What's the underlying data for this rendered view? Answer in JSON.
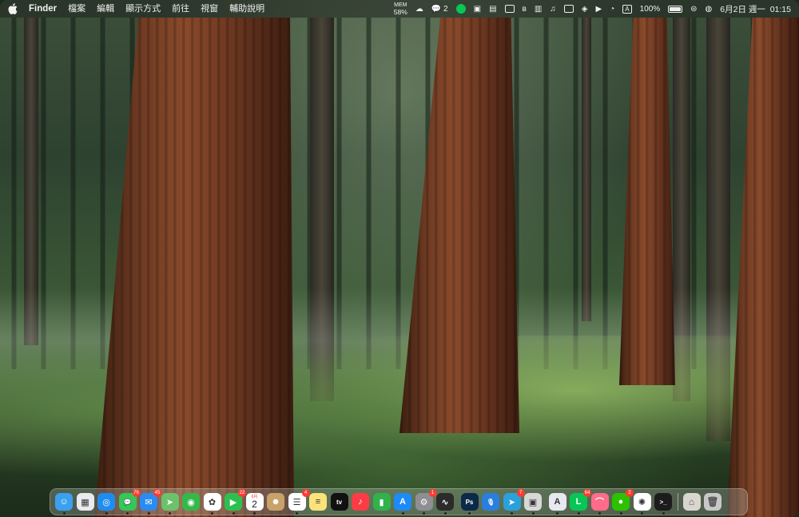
{
  "menubar": {
    "app_name": "Finder",
    "menus": [
      "檔案",
      "編輯",
      "顯示方式",
      "前往",
      "視窗",
      "輔助說明"
    ],
    "mem_label": "MEM",
    "mem_value": "58%",
    "wechat_count": "2",
    "battery_percent": "100%",
    "date_time": "6月2日 週一  01:15"
  },
  "dock": {
    "apps": [
      {
        "name": "Finder",
        "color": "#3aa0f0",
        "badge": "",
        "running": true,
        "glyph": "☺"
      },
      {
        "name": "Launchpad",
        "color": "#e9e9ef",
        "badge": "",
        "running": false,
        "glyph": "▦"
      },
      {
        "name": "Safari",
        "color": "#1f8cf0",
        "badge": "",
        "running": true,
        "glyph": "◎"
      },
      {
        "name": "Messages",
        "color": "#34c759",
        "badge": "76",
        "running": true,
        "glyph": "💬"
      },
      {
        "name": "Mail",
        "color": "#2a8bf2",
        "badge": "45",
        "running": true,
        "glyph": "✉"
      },
      {
        "name": "Maps",
        "color": "#6cc26a",
        "badge": "",
        "running": true,
        "glyph": "➤"
      },
      {
        "name": "Find My",
        "color": "#35b84a",
        "badge": "",
        "running": false,
        "glyph": "◉"
      },
      {
        "name": "Photos",
        "color": "#ffffff",
        "badge": "",
        "running": true,
        "glyph": "✿"
      },
      {
        "name": "FaceTime",
        "color": "#2fbf4f",
        "badge": "22",
        "running": true,
        "glyph": "▶"
      },
      {
        "name": "Calendar",
        "color": "#ffffff",
        "badge": "",
        "running": true,
        "glyph": ""
      },
      {
        "name": "Contacts",
        "color": "#c8a26a",
        "badge": "",
        "running": false,
        "glyph": "☻"
      },
      {
        "name": "Reminders",
        "color": "#ffffff",
        "badge": "4",
        "running": true,
        "glyph": "☰"
      },
      {
        "name": "Notes",
        "color": "#fbe27a",
        "badge": "",
        "running": false,
        "glyph": "≡"
      },
      {
        "name": "TV",
        "color": "#111111",
        "badge": "",
        "running": false,
        "glyph": "tv"
      },
      {
        "name": "Music",
        "color": "#fc3c44",
        "badge": "",
        "running": false,
        "glyph": "♪"
      },
      {
        "name": "Numbers",
        "color": "#31b24a",
        "badge": "",
        "running": false,
        "glyph": "▮"
      },
      {
        "name": "App Store",
        "color": "#1c8bf7",
        "badge": "",
        "running": true,
        "glyph": "A"
      },
      {
        "name": "System Settings",
        "color": "#8e8e93",
        "badge": "1",
        "running": true,
        "glyph": "⚙"
      },
      {
        "name": "Activity Monitor",
        "color": "#2b2b2b",
        "badge": "",
        "running": true,
        "glyph": "∿"
      },
      {
        "name": "Photoshop",
        "color": "#0b2a4a",
        "badge": "",
        "running": true,
        "glyph": "Ps"
      },
      {
        "name": "Voice Memos",
        "color": "#2a7fdc",
        "badge": "",
        "running": false,
        "glyph": "🎙"
      },
      {
        "name": "Telegram",
        "color": "#2aa1da",
        "badge": "7",
        "running": true,
        "glyph": "➤"
      },
      {
        "name": "Preview",
        "color": "#d8d8d8",
        "badge": "",
        "running": true,
        "glyph": "▣"
      },
      {
        "name": "Adobe Creative Cloud",
        "color": "#e8e8f0",
        "badge": "",
        "running": true,
        "glyph": "A"
      },
      {
        "name": "LINE",
        "color": "#06c755",
        "badge": "64",
        "running": true,
        "glyph": "L"
      },
      {
        "name": "Arc",
        "color": "#ff6b8a",
        "badge": "",
        "running": true,
        "glyph": "⌒"
      },
      {
        "name": "WeChat",
        "color": "#2dc100",
        "badge": "2",
        "running": true,
        "glyph": "●"
      },
      {
        "name": "ChatGPT",
        "color": "#ffffff",
        "badge": "",
        "running": true,
        "glyph": "✺"
      },
      {
        "name": "Terminal",
        "color": "#1c1c1c",
        "badge": "",
        "running": true,
        "glyph": ">_"
      }
    ],
    "trailing": [
      {
        "name": "Downloads",
        "color": "#d9d6d0",
        "glyph": "⌂"
      },
      {
        "name": "Trash",
        "color": "#c8c8c8",
        "glyph": "🗑"
      }
    ],
    "calendar_month": "6月",
    "calendar_day": "2",
    "tv_label": "tv"
  }
}
